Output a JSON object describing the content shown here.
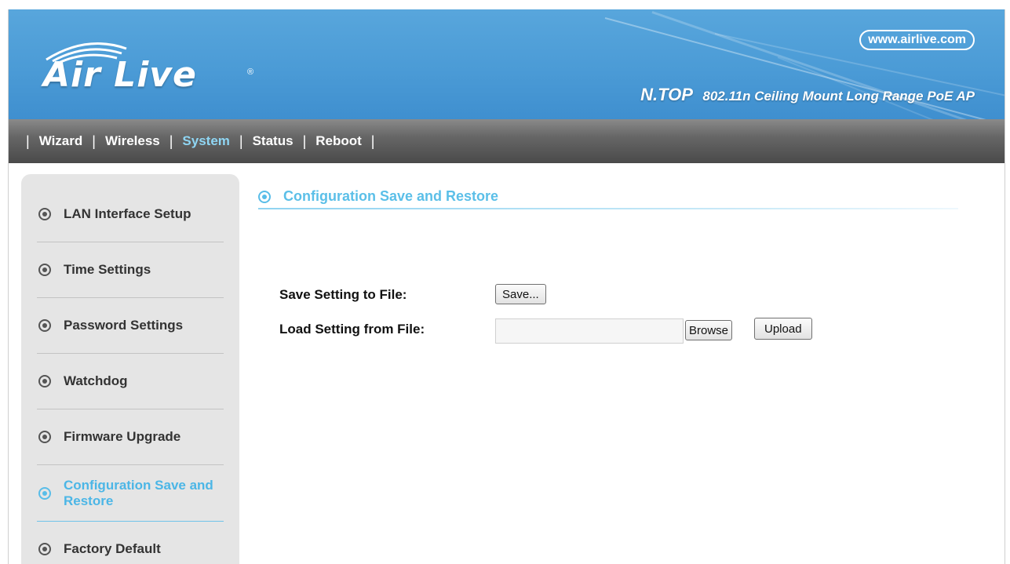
{
  "header": {
    "logo_text": "Air Live",
    "logo_mark": "®",
    "website": "www.airlive.com",
    "product_brand": "N.TOP",
    "product_desc": "802.11n Ceiling Mount Long Range PoE AP"
  },
  "nav": {
    "separator": "|",
    "items": [
      {
        "label": "Wizard"
      },
      {
        "label": "Wireless"
      },
      {
        "label": "System",
        "active": true
      },
      {
        "label": "Status"
      },
      {
        "label": "Reboot"
      }
    ]
  },
  "sidebar": {
    "items": [
      {
        "label": "LAN Interface Setup"
      },
      {
        "label": "Time Settings"
      },
      {
        "label": "Password Settings"
      },
      {
        "label": "Watchdog"
      },
      {
        "label": "Firmware Upgrade"
      },
      {
        "label": "Configuration Save and Restore",
        "active": true
      },
      {
        "label": "Factory Default"
      }
    ]
  },
  "main": {
    "section_title": "Configuration Save and Restore",
    "save_label": "Save Setting to File:",
    "save_button": "Save...",
    "load_label": "Load Setting from File:",
    "file_value": "",
    "browse_button": "Browse",
    "upload_button": "Upload"
  },
  "colors": {
    "banner": "#4b9bd6",
    "accent": "#59bde8",
    "nav_active": "#8fd6f4"
  },
  "icons": {
    "sidebar_bullet": "radio-bullet-icon",
    "logo_arcs": "wireless-arcs-icon"
  }
}
